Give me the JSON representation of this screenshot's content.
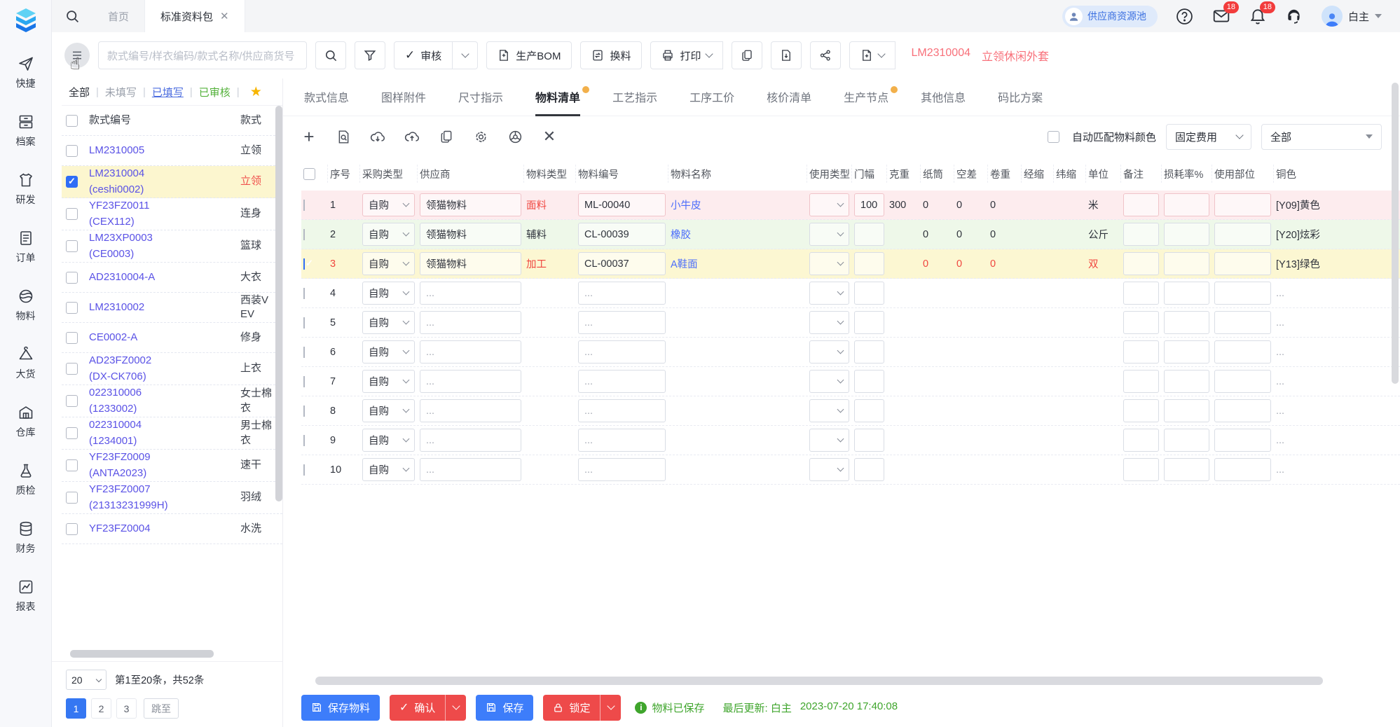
{
  "topbar": {
    "home_tab": "首页",
    "doc_tab": "标准资料包",
    "supplier_pool": "供应商资源池",
    "mail_badge": "18",
    "bell_badge": "18",
    "user_name": "白主"
  },
  "toolbar": {
    "search_placeholder": "款式编号/样衣编码/款式名称/供应商货号",
    "audit_label": "审核",
    "bom_label": "生产BOM",
    "swap_label": "换料",
    "print_label": "打印",
    "style_code": "LM2310004",
    "style_name": "立领休闲外套"
  },
  "sidebar_items": [
    {
      "icon": "quick-icon",
      "label": "快捷"
    },
    {
      "icon": "archive-icon",
      "label": "档案"
    },
    {
      "icon": "rnd-icon",
      "label": "研发"
    },
    {
      "icon": "order-icon",
      "label": "订单"
    },
    {
      "icon": "material-icon",
      "label": "物料"
    },
    {
      "icon": "bulk-icon",
      "label": "大货"
    },
    {
      "icon": "warehouse-icon",
      "label": "仓库"
    },
    {
      "icon": "qc-icon",
      "label": "质检"
    },
    {
      "icon": "finance-icon",
      "label": "财务"
    },
    {
      "icon": "report-icon",
      "label": "报表"
    }
  ],
  "left_panel": {
    "filters": [
      {
        "label": "全部",
        "state": "default"
      },
      {
        "label": "未填写",
        "state": "muted"
      },
      {
        "label": "已填写",
        "state": "active"
      },
      {
        "label": "已审核",
        "state": "green"
      }
    ],
    "col_code": "款式编号",
    "col_name": "款式",
    "items": [
      {
        "code": "LM2310005",
        "sub": "",
        "name": "立领",
        "checked": false,
        "selected": false
      },
      {
        "code": "LM2310004",
        "sub": "(ceshi0002)",
        "name": "立领",
        "checked": true,
        "selected": true
      },
      {
        "code": "YF23FZ0011",
        "sub": "(CEX112)",
        "name": "连身",
        "checked": false,
        "selected": false
      },
      {
        "code": "LM23XP0003",
        "sub": "(CE0003)",
        "name": "篮球",
        "checked": false,
        "selected": false
      },
      {
        "code": "AD2310004-A",
        "sub": "",
        "name": "大衣",
        "checked": false,
        "selected": false
      },
      {
        "code": "LM2310002",
        "sub": "",
        "name": "西装VEV",
        "checked": false,
        "selected": false
      },
      {
        "code": "CE0002-A",
        "sub": "",
        "name": "修身",
        "checked": false,
        "selected": false
      },
      {
        "code": "AD23FZ0002",
        "sub": "(DX-CK706)",
        "name": "上衣",
        "checked": false,
        "selected": false
      },
      {
        "code": "022310006",
        "sub": "(1233002)",
        "name": "女士棉衣",
        "checked": false,
        "selected": false
      },
      {
        "code": "022310004",
        "sub": "(1234001)",
        "name": "男士棉衣",
        "checked": false,
        "selected": false
      },
      {
        "code": "YF23FZ0009",
        "sub": "(ANTA2023)",
        "name": "速干",
        "checked": false,
        "selected": false
      },
      {
        "code": "YF23FZ0007",
        "sub": "(21313231999H)",
        "name": "羽绒",
        "checked": false,
        "selected": false
      },
      {
        "code": "YF23FZ0004",
        "sub": "",
        "name": "水洗",
        "checked": false,
        "selected": false
      }
    ],
    "page_size": "20",
    "range_text": "第1至20条，共52条",
    "pages": [
      "1",
      "2",
      "3"
    ],
    "active_page": "1",
    "jump_label": "跳至"
  },
  "main_tabs": [
    {
      "label": "款式信息",
      "dot": false,
      "active": false
    },
    {
      "label": "图样附件",
      "dot": false,
      "active": false
    },
    {
      "label": "尺寸指示",
      "dot": false,
      "active": false
    },
    {
      "label": "物料清单",
      "dot": true,
      "active": true
    },
    {
      "label": "工艺指示",
      "dot": false,
      "active": false
    },
    {
      "label": "工序工价",
      "dot": false,
      "active": false
    },
    {
      "label": "核价清单",
      "dot": false,
      "active": false
    },
    {
      "label": "生产节点",
      "dot": true,
      "active": false
    },
    {
      "label": "其他信息",
      "dot": false,
      "active": false
    },
    {
      "label": "码比方案",
      "dot": false,
      "active": false
    }
  ],
  "bom_controls": {
    "auto_match_label": "自动匹配物料颜色",
    "fee_select": "固定费用",
    "scope_select": "全部"
  },
  "bom_table": {
    "headers": [
      "序号",
      "采购类型",
      "供应商",
      "物料类型",
      "物料编号",
      "物料名称",
      "使用类型",
      "门幅",
      "克重",
      "纸筒",
      "空差",
      "卷重",
      "经缩",
      "纬缩",
      "单位",
      "备注",
      "损耗率%",
      "使用部位",
      "铜色"
    ],
    "rows": [
      {
        "no": "1",
        "purchase": "自购",
        "supplier": "领猫物料",
        "material_type": "面料",
        "material_type_red": true,
        "code": "ML-00040",
        "name": "小牛皮",
        "width": "100",
        "weight": "300",
        "tube": "0",
        "gap": "0",
        "roll": "0",
        "unit": "米",
        "color": "[Y09]黄色",
        "hl": "pink",
        "checked": false,
        "red": false
      },
      {
        "no": "2",
        "purchase": "自购",
        "supplier": "领猫物料",
        "material_type": "辅料",
        "material_type_red": false,
        "code": "CL-00039",
        "name": "橡胶",
        "width": "",
        "weight": "",
        "tube": "0",
        "gap": "0",
        "roll": "0",
        "unit": "公斤",
        "color": "[Y20]炫彩",
        "hl": "green",
        "checked": false,
        "red": false
      },
      {
        "no": "3",
        "purchase": "自购",
        "supplier": "领猫物料",
        "material_type": "加工",
        "material_type_red": true,
        "code": "CL-00037",
        "name": "A鞋面",
        "width": "",
        "weight": "",
        "tube": "0",
        "gap": "0",
        "roll": "0",
        "unit": "双",
        "color": "[Y13]绿色",
        "hl": "yellow",
        "checked": true,
        "red": true
      },
      {
        "no": "4",
        "purchase": "自购",
        "supplier": "...",
        "material_type": "",
        "material_type_red": false,
        "code": "...",
        "name": "",
        "width": "",
        "weight": "",
        "tube": "",
        "gap": "",
        "roll": "",
        "unit": "",
        "color": "...",
        "hl": "",
        "checked": false,
        "red": false
      },
      {
        "no": "5",
        "purchase": "自购",
        "supplier": "...",
        "material_type": "",
        "material_type_red": false,
        "code": "...",
        "name": "",
        "width": "",
        "weight": "",
        "tube": "",
        "gap": "",
        "roll": "",
        "unit": "",
        "color": "...",
        "hl": "",
        "checked": false,
        "red": false
      },
      {
        "no": "6",
        "purchase": "自购",
        "supplier": "...",
        "material_type": "",
        "material_type_red": false,
        "code": "...",
        "name": "",
        "width": "",
        "weight": "",
        "tube": "",
        "gap": "",
        "roll": "",
        "unit": "",
        "color": "...",
        "hl": "",
        "checked": false,
        "red": false
      },
      {
        "no": "7",
        "purchase": "自购",
        "supplier": "...",
        "material_type": "",
        "material_type_red": false,
        "code": "...",
        "name": "",
        "width": "",
        "weight": "",
        "tube": "",
        "gap": "",
        "roll": "",
        "unit": "",
        "color": "...",
        "hl": "",
        "checked": false,
        "red": false
      },
      {
        "no": "8",
        "purchase": "自购",
        "supplier": "...",
        "material_type": "",
        "material_type_red": false,
        "code": "...",
        "name": "",
        "width": "",
        "weight": "",
        "tube": "",
        "gap": "",
        "roll": "",
        "unit": "",
        "color": "...",
        "hl": "",
        "checked": false,
        "red": false
      },
      {
        "no": "9",
        "purchase": "自购",
        "supplier": "...",
        "material_type": "",
        "material_type_red": false,
        "code": "...",
        "name": "",
        "width": "",
        "weight": "",
        "tube": "",
        "gap": "",
        "roll": "",
        "unit": "",
        "color": "...",
        "hl": "",
        "checked": false,
        "red": false
      },
      {
        "no": "10",
        "purchase": "自购",
        "supplier": "...",
        "material_type": "",
        "material_type_red": false,
        "code": "...",
        "name": "",
        "width": "",
        "weight": "",
        "tube": "",
        "gap": "",
        "roll": "",
        "unit": "",
        "color": "...",
        "hl": "",
        "checked": false,
        "red": false
      }
    ]
  },
  "footer": {
    "save_material": "保存物料",
    "confirm": "确认",
    "save": "保存",
    "lock": "锁定",
    "status": "物料已保存",
    "updated_label": "最后更新: 白主",
    "updated_time": "2023-07-20 17:40:08"
  }
}
